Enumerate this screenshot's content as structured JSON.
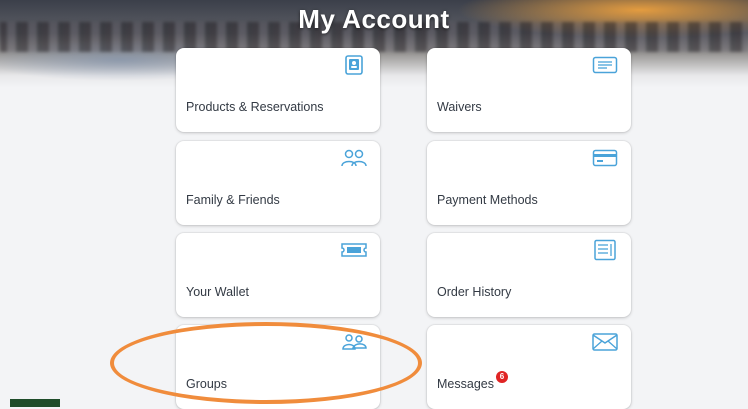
{
  "header": {
    "title": "My Account"
  },
  "cards": [
    {
      "label": "Products & Reservations",
      "icon": "id-card-icon"
    },
    {
      "label": "Waivers",
      "icon": "document-icon"
    },
    {
      "label": "Family & Friends",
      "icon": "people-icon"
    },
    {
      "label": "Payment Methods",
      "icon": "credit-card-icon"
    },
    {
      "label": "Your Wallet",
      "icon": "ticket-icon"
    },
    {
      "label": "Order History",
      "icon": "receipt-icon"
    },
    {
      "label": "Groups",
      "icon": "group-icon"
    },
    {
      "label": "Messages",
      "icon": "envelope-icon",
      "badge": "6"
    }
  ],
  "colors": {
    "accent": "#4aa3d9",
    "highlight": "#f08c3c",
    "badge": "#e02424"
  }
}
